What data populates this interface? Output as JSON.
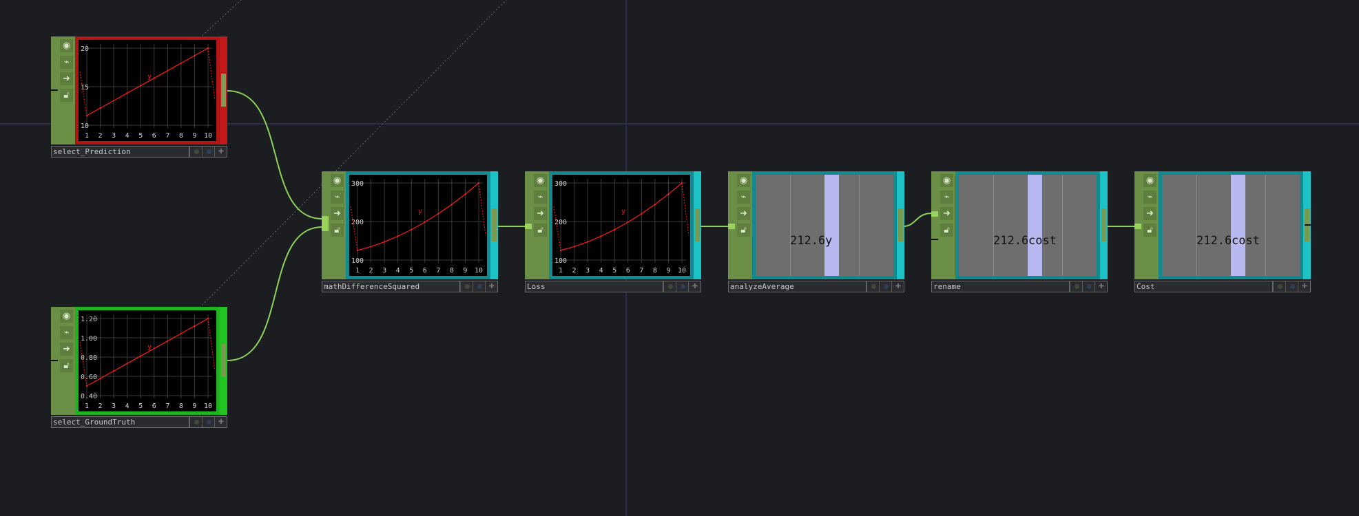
{
  "nodes": {
    "select_prediction": {
      "name": "select_Prediction",
      "channel": "y",
      "y_ticks": [
        "20",
        "15",
        "10"
      ],
      "x_ticks": [
        "1",
        "2",
        "3",
        "4",
        "5",
        "6",
        "7",
        "8",
        "9",
        "10"
      ],
      "color": "#b01616"
    },
    "select_groundtruth": {
      "name": "select_GroundTruth",
      "channel": "y",
      "y_ticks": [
        "1.20",
        "1.00",
        "0.80",
        "0.60",
        "0.40"
      ],
      "x_ticks": [
        "1",
        "2",
        "3",
        "4",
        "5",
        "6",
        "7",
        "8",
        "9",
        "10"
      ],
      "color": "#1fb31f"
    },
    "math_difference_squared": {
      "name": "mathDifferenceSquared",
      "channel": "y",
      "y_ticks": [
        "300",
        "200",
        "100"
      ],
      "x_ticks": [
        "1",
        "2",
        "3",
        "4",
        "5",
        "6",
        "7",
        "8",
        "9",
        "10"
      ],
      "color": "#138a8f"
    },
    "loss": {
      "name": "Loss",
      "channel": "y",
      "y_ticks": [
        "300",
        "200",
        "100"
      ],
      "x_ticks": [
        "1",
        "2",
        "3",
        "4",
        "5",
        "6",
        "7",
        "8",
        "9",
        "10"
      ],
      "color": "#138a8f"
    },
    "analyze_average": {
      "name": "analyzeAverage",
      "value": "212.6",
      "channel": "y",
      "color": "#138a8f"
    },
    "rename": {
      "name": "rename",
      "value": "212.6",
      "channel": "cost",
      "color": "#138a8f"
    },
    "cost": {
      "name": "Cost",
      "value": "212.6",
      "channel": "cost",
      "color": "#138a8f"
    }
  },
  "icons": [
    "viewer-toggle-icon",
    "graph-icon",
    "arrow-right-icon",
    "lock-icon",
    "bypass-dot-icon",
    "display-dot-icon",
    "pin-plus-icon"
  ],
  "colors": {
    "background": "#1c1d21",
    "wire": "#8fd45a",
    "line": "#ff1a1a",
    "operator_strip": "#6b8f47"
  }
}
